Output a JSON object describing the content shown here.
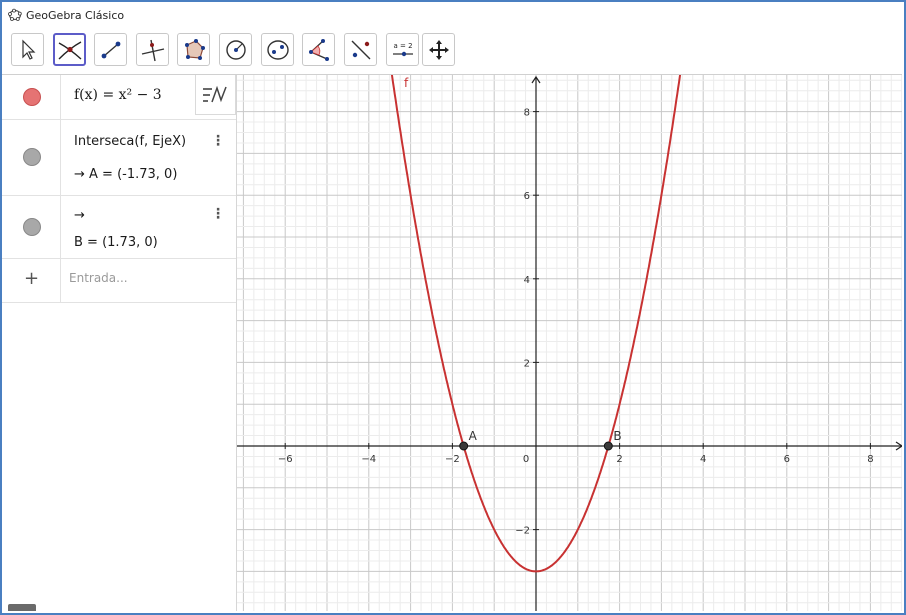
{
  "window": {
    "title": "GeoGebra Clásico"
  },
  "toolbar": {
    "tools": [
      {
        "name": "move-tool-icon",
        "selected": false
      },
      {
        "name": "intersect-tool-icon",
        "selected": true
      },
      {
        "name": "segment-tool-icon",
        "selected": false
      },
      {
        "name": "perpendicular-line-tool-icon",
        "selected": false
      },
      {
        "name": "polygon-tool-icon",
        "selected": false
      },
      {
        "name": "circle-tool-icon",
        "selected": false
      },
      {
        "name": "ellipse-tool-icon",
        "selected": false
      },
      {
        "name": "angle-tool-icon",
        "selected": false
      },
      {
        "name": "reflect-tool-icon",
        "selected": false
      },
      {
        "name": "slider-tool-icon",
        "selected": false
      },
      {
        "name": "move-graphics-view-tool-icon",
        "selected": false
      }
    ],
    "slider_tool_text": "a = 2"
  },
  "algebra": {
    "row1": {
      "color": "#e57373",
      "formula": "f(x) = x² − 3"
    },
    "row2": {
      "color": "#a8a8a8",
      "definition": "Interseca(f, EjeX)",
      "value": "→ A = (-1.73, 0)"
    },
    "row3": {
      "color": "#a8a8a8",
      "definition": "→",
      "value": "B = (1.73, 0)"
    },
    "input": {
      "plus": "+",
      "placeholder": "Entrada..."
    }
  },
  "graphics": {
    "curve_label": "f",
    "curve_color": "#c83232",
    "x_axis_ticks": [
      "−6",
      "−4",
      "−2",
      "0",
      "2",
      "4",
      "6",
      "8"
    ],
    "y_axis_ticks": [
      "8",
      "6",
      "4",
      "2",
      "−2"
    ],
    "points": [
      {
        "name": "A",
        "x": -1.73,
        "y": 0
      },
      {
        "name": "B",
        "x": 1.73,
        "y": 0
      }
    ]
  },
  "chart_data": {
    "type": "line",
    "title": "",
    "xlabel": "",
    "ylabel": "",
    "xlim": [
      -7,
      9
    ],
    "ylim": [
      -3.8,
      9
    ],
    "grid": true,
    "series": [
      {
        "name": "f",
        "function": "x^2 - 3"
      }
    ]
  }
}
